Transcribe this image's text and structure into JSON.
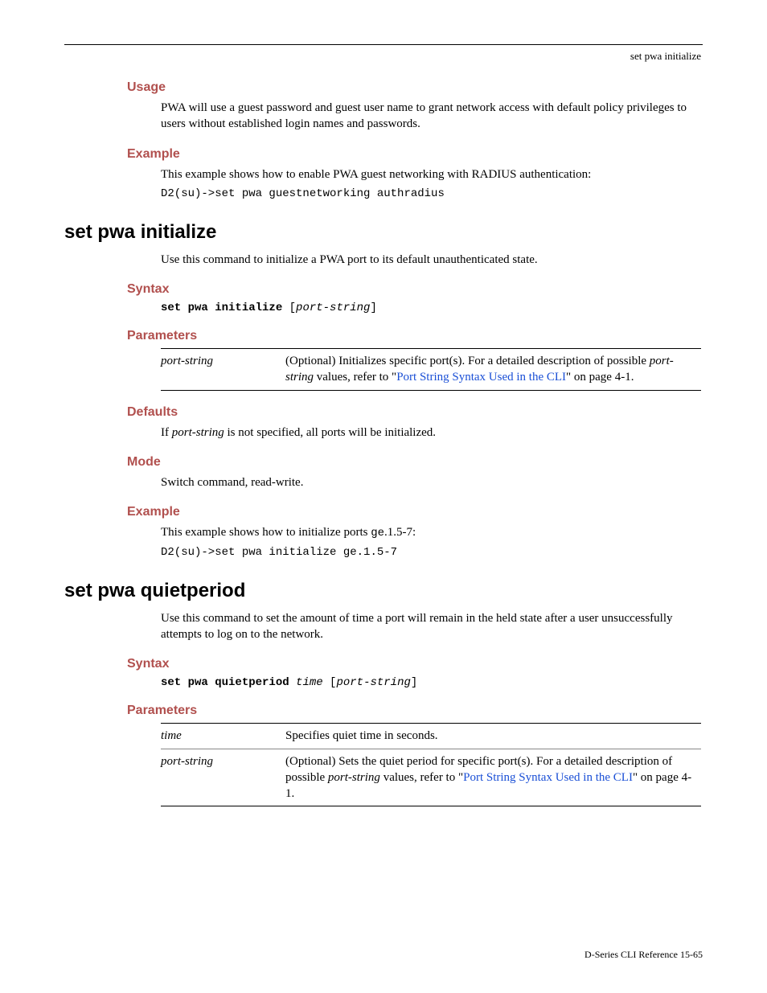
{
  "header": {
    "right": "set pwa initialize"
  },
  "s1": {
    "usage_h": "Usage",
    "usage_p": "PWA will use a guest password and guest user name to grant network access with default policy privileges to users without established login names and passwords.",
    "example_h": "Example",
    "example_p": "This example shows how to enable PWA guest networking with RADIUS authentication:",
    "example_code": "D2(su)->set pwa guestnetworking authradius"
  },
  "cmd1": {
    "title": "set pwa initialize",
    "desc": "Use this command to initialize a PWA port to its default unauthenticated state.",
    "syntax_h": "Syntax",
    "syntax_kw": "set pwa initialize",
    "syntax_open": " [",
    "syntax_arg": "port-string",
    "syntax_close": "]",
    "params_h": "Parameters",
    "param1_name": "port-string",
    "param1_pre": "(Optional) Initializes specific port(s). For a detailed description of possible ",
    "param1_italic": "port-string",
    "param1_mid": " values, refer to \"",
    "param1_link": "Port String Syntax Used in the CLI",
    "param1_post": "\" on page 4-1.",
    "defaults_h": "Defaults",
    "defaults_pre": "If ",
    "defaults_italic": "port-string",
    "defaults_post": " is not specified, all ports will be initialized.",
    "mode_h": "Mode",
    "mode_p": "Switch command, read-write.",
    "example_h": "Example",
    "example_pre": "This example shows how to initialize ports ",
    "example_mono": "ge",
    "example_post": ".1.5-7:",
    "example_code": "D2(su)->set pwa initialize ge.1.5-7"
  },
  "cmd2": {
    "title": "set pwa quietperiod",
    "desc": "Use this command to set the amount of time a port will remain in the held state after a user unsuccessfully attempts to log on to the network.",
    "syntax_h": "Syntax",
    "syntax_kw": "set pwa quietperiod",
    "syntax_sp": " ",
    "syntax_arg1": "time",
    "syntax_open": " [",
    "syntax_arg2": "port-string",
    "syntax_close": "]",
    "params_h": "Parameters",
    "param1_name": "time",
    "param1_desc": "Specifies quiet time in seconds.",
    "param2_name": "port-string",
    "param2_pre": "(Optional) Sets the quiet period for specific port(s). For a detailed description of possible ",
    "param2_italic": "port-string",
    "param2_mid": " values, refer to \"",
    "param2_link": "Port String Syntax Used in the CLI",
    "param2_post": "\" on page 4-1."
  },
  "footer": {
    "text": "D-Series CLI Reference    15-65"
  }
}
